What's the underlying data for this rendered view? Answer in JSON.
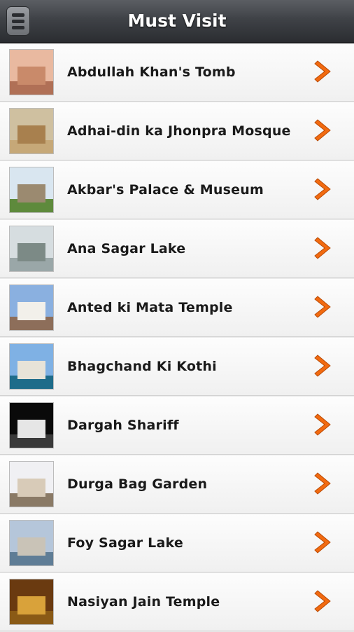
{
  "header": {
    "title": "Must Visit",
    "menu_icon": "menu-icon"
  },
  "places": [
    {
      "name": "Abdullah Khan's Tomb",
      "thumb": {
        "sky": "#e9b9a0",
        "bldg": "#c98a6a",
        "ground": "#b07056"
      }
    },
    {
      "name": "Adhai-din ka Jhonpra Mosque",
      "thumb": {
        "sky": "#cfc0a0",
        "bldg": "#a8804e",
        "ground": "#c6a878"
      }
    },
    {
      "name": "Akbar's Palace & Museum",
      "thumb": {
        "sky": "#d9e6f0",
        "bldg": "#9b8a70",
        "ground": "#5e8a3c"
      }
    },
    {
      "name": "Ana Sagar Lake",
      "thumb": {
        "sky": "#d6dde0",
        "bldg": "#7c8a86",
        "ground": "#9aa7a8"
      }
    },
    {
      "name": "Anted ki Mata Temple",
      "thumb": {
        "sky": "#8ab0e0",
        "bldg": "#f2f0ea",
        "ground": "#8d6e5a"
      }
    },
    {
      "name": "Bhagchand Ki Kothi",
      "thumb": {
        "sky": "#7fb1e4",
        "bldg": "#e7e3d8",
        "ground": "#1e6c8a"
      }
    },
    {
      "name": "Dargah Shariff",
      "thumb": {
        "sky": "#0a0a0a",
        "bldg": "#e6e6e6",
        "ground": "#3a3a3a"
      }
    },
    {
      "name": "Durga Bag Garden",
      "thumb": {
        "sky": "#f0f0f3",
        "bldg": "#d8cbb8",
        "ground": "#8a7a66"
      }
    },
    {
      "name": "Foy Sagar Lake",
      "thumb": {
        "sky": "#b5c6da",
        "bldg": "#c9c3b7",
        "ground": "#5f7d96"
      }
    },
    {
      "name": "Nasiyan Jain Temple",
      "thumb": {
        "sky": "#6a3a10",
        "bldg": "#d9a23a",
        "ground": "#8a5a16"
      }
    }
  ],
  "arrow_icon": "chevron-right-icon",
  "colors": {
    "arrow": "#f26a10",
    "header": "#3f4247"
  }
}
